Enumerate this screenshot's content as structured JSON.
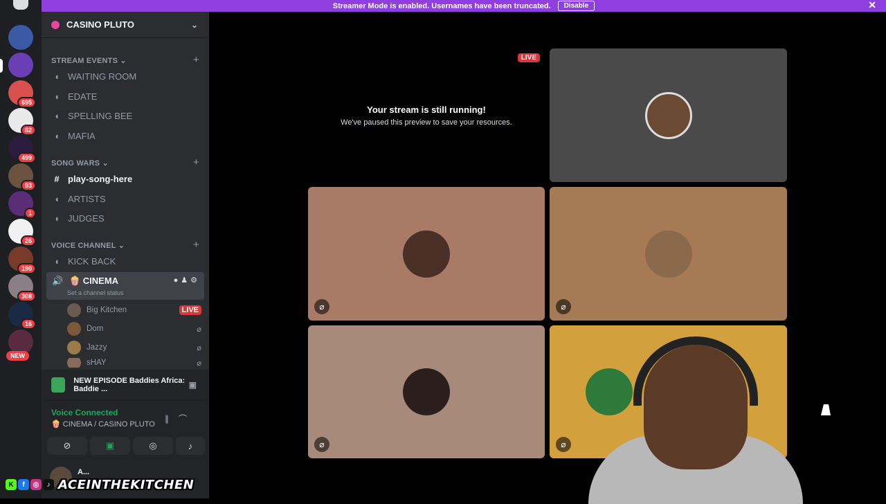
{
  "banner": {
    "text": "Streamer Mode is enabled. Usernames have been truncated.",
    "disable_label": "Disable",
    "close_icon": "close-icon"
  },
  "server_rail": {
    "badges": [
      "695",
      "82",
      "499",
      "93",
      "1",
      "26",
      "190",
      "308",
      "16"
    ],
    "new_label": "NEW"
  },
  "server": {
    "name": "CASINO PLUTO"
  },
  "categories": {
    "stream_events": {
      "label": "STREAM EVENTS",
      "channels": [
        "WAITING ROOM",
        "EDATE",
        "SPELLING BEE",
        "MAFIA"
      ]
    },
    "song_wars": {
      "label": "SONG WARS",
      "channels": [
        "play-song-here",
        "ARTISTS",
        "JUDGES"
      ]
    },
    "voice_channel": {
      "label": "VOICE CHANNEL",
      "channels": [
        "KICK BACK"
      ]
    }
  },
  "active_channel": {
    "name": "🍿 CINEMA",
    "status": "Set a channel status"
  },
  "voice_users": [
    {
      "name": "Big Kitchen",
      "badge": "LIVE"
    },
    {
      "name": "Dom"
    },
    {
      "name": "Jazzy"
    },
    {
      "name": "sHAY"
    }
  ],
  "activity": {
    "title": "NEW EPISODE Baddies Africa: Baddie ..."
  },
  "voice_panel": {
    "status": "Voice Connected",
    "location": "🍿 CINEMA / CASINO PLUTO"
  },
  "user": {
    "name": "A..."
  },
  "stream": {
    "live_label": "LIVE",
    "title": "Your stream is still running!",
    "subtitle": "We've paused this preview to save your resources."
  },
  "colors": {
    "accent": "#8f3fe0",
    "live": "#da373c",
    "connected": "#23a559",
    "tile_1": "#4a4a4a",
    "tile_2": "#a97a66",
    "tile_3": "#a57a55",
    "tile_4": "#a88a7b",
    "tile_5": "#d3a03e"
  },
  "overlay": {
    "handle": "ACEINTHEKITCHEN"
  }
}
